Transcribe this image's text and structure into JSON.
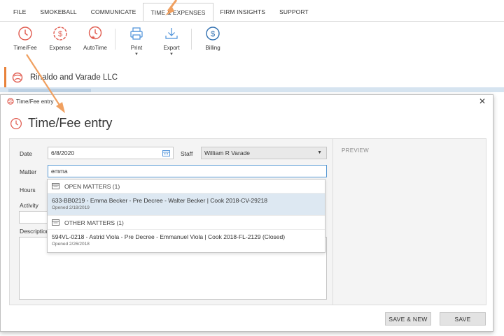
{
  "menu": {
    "tabs": [
      "FILE",
      "SMOKEBALL",
      "COMMUNICATE",
      "TIME & EXPENSES",
      "FIRM INSIGHTS",
      "SUPPORT"
    ],
    "active_tab": "TIME & EXPENSES"
  },
  "ribbon": {
    "time_fee": "Time/Fee",
    "expense": "Expense",
    "autotime": "AutoTime",
    "print": "Print",
    "export": "Export",
    "billing": "Billing"
  },
  "matter_bar": {
    "name": "Rinaldo and Varade LLC"
  },
  "dialog": {
    "window_title": "Time/Fee entry",
    "heading": "Time/Fee entry",
    "labels": {
      "date": "Date",
      "staff": "Staff",
      "matter": "Matter",
      "hours": "Hours",
      "activity": "Activity",
      "description": "Description"
    },
    "date_value": "6/8/2020",
    "staff_value": "William R Varade",
    "matter_value": "emma",
    "preview_label": "PREVIEW",
    "dropdown": {
      "open_header": "OPEN MATTERS (1)",
      "open_item_main": "633-BB0219 - Emma Becker - Pre Decree - Walter Becker | Cook 2018-CV-29218",
      "open_item_sub": "Opened 2/18/2019",
      "other_header": "OTHER MATTERS (1)",
      "other_item_main": "594VL-0218 - Astrid Viola - Pre Decree - Emmanuel Viola | Cook 2018-FL-2129 (Closed)",
      "other_item_sub": "Opened 2/26/2018"
    },
    "save_new": "SAVE & NEW",
    "save": "SAVE"
  },
  "colors": {
    "accent": "#e05a4e",
    "orange": "#e8823a",
    "billing_blue": "#2f6fb0",
    "highlight": "#dde8f2"
  }
}
